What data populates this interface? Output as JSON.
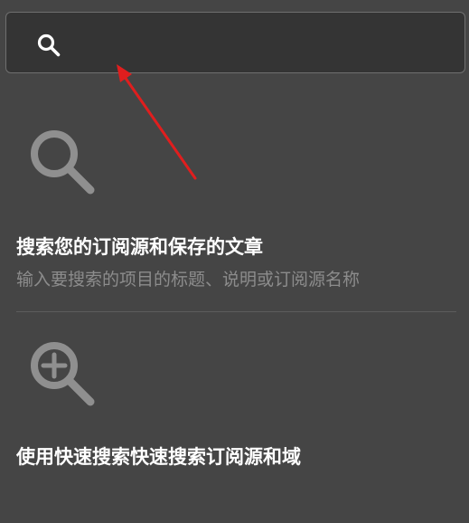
{
  "search": {
    "value": "",
    "placeholder": ""
  },
  "tips": [
    {
      "icon": "magnifier-icon",
      "title": "搜索您的订阅源和保存的文章",
      "description": "输入要搜索的项目的标题、说明或订阅源名称"
    },
    {
      "icon": "zoom-in-icon",
      "title": "使用快速搜索快速搜索订阅源和域"
    }
  ],
  "colors": {
    "background": "#454545",
    "search_box": "#343434",
    "icon_gray": "#909090",
    "annotation_arrow": "#e01e1e"
  }
}
